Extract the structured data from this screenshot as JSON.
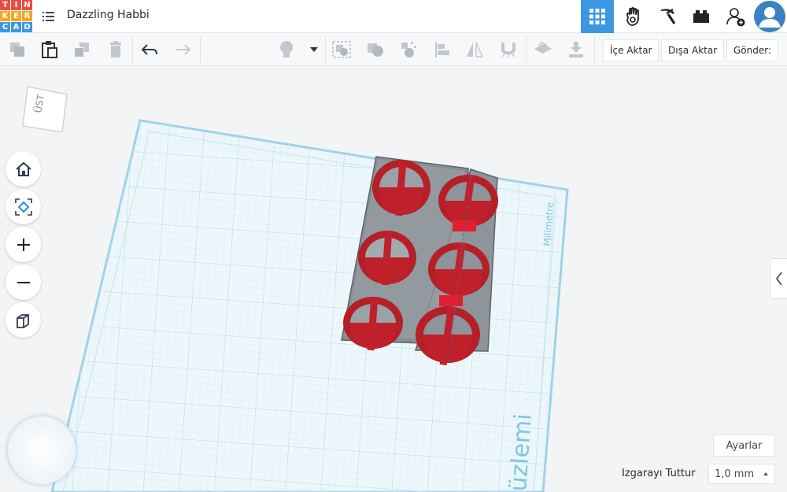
{
  "app": {
    "logo_letters": [
      "T",
      "I",
      "N",
      "K",
      "E",
      "R",
      "C",
      "A",
      "D"
    ],
    "logo_colors": [
      "#e84e43",
      "#e84e43",
      "#e84e43",
      "#f6a623",
      "#f6a623",
      "#f6a623",
      "#3c97e3",
      "#3c97e3",
      "#3c97e3"
    ],
    "project_title": "Dazzling Habbi",
    "accent_color": "#3c97e3"
  },
  "nav": {
    "buttons": [
      {
        "name": "3d-design-view",
        "icon": "grid-icon",
        "active": true
      },
      {
        "name": "circuits-view",
        "icon": "hand-icon",
        "active": false
      },
      {
        "name": "minecraft-view",
        "icon": "pickaxe-icon",
        "active": false
      },
      {
        "name": "lego-view",
        "icon": "brick-icon",
        "active": false
      },
      {
        "name": "invite-people",
        "icon": "add-user-icon",
        "active": false
      }
    ],
    "avatar_icon": "user-avatar-icon"
  },
  "toolbar": {
    "icons": [
      "copy-icon",
      "paste-icon",
      "duplicate-icon",
      "delete-icon",
      "undo-icon",
      "redo-icon",
      "lightbulb-icon",
      "dropdown-icon",
      "group-icon",
      "ungroup-icon",
      "align-icon",
      "mirror-icon",
      "magnet-icon",
      "flip-icon",
      "cruise-icon"
    ],
    "import_label": "İçe Aktar",
    "export_label": "Dışa Aktar",
    "send_label": "Gönder:"
  },
  "viewcube": {
    "face_label": "ÜST"
  },
  "side_tools": [
    "home-icon",
    "fit-view-icon",
    "zoom-in-icon",
    "zoom-out-icon",
    "projection-icon"
  ],
  "workplane": {
    "units_label": "Milimetre",
    "plane_label": "Çalışma Düzlemi",
    "plane_label_visible": "üzlemi"
  },
  "bottom": {
    "settings_label": "Ayarlar",
    "snap_label": "Izgarayı Tuttur",
    "snap_value": "1,0 mm"
  },
  "colors": {
    "shape_red": "#c0202a",
    "shape_gray": "#8d949b",
    "grid_blue": "#a9d8ea"
  }
}
